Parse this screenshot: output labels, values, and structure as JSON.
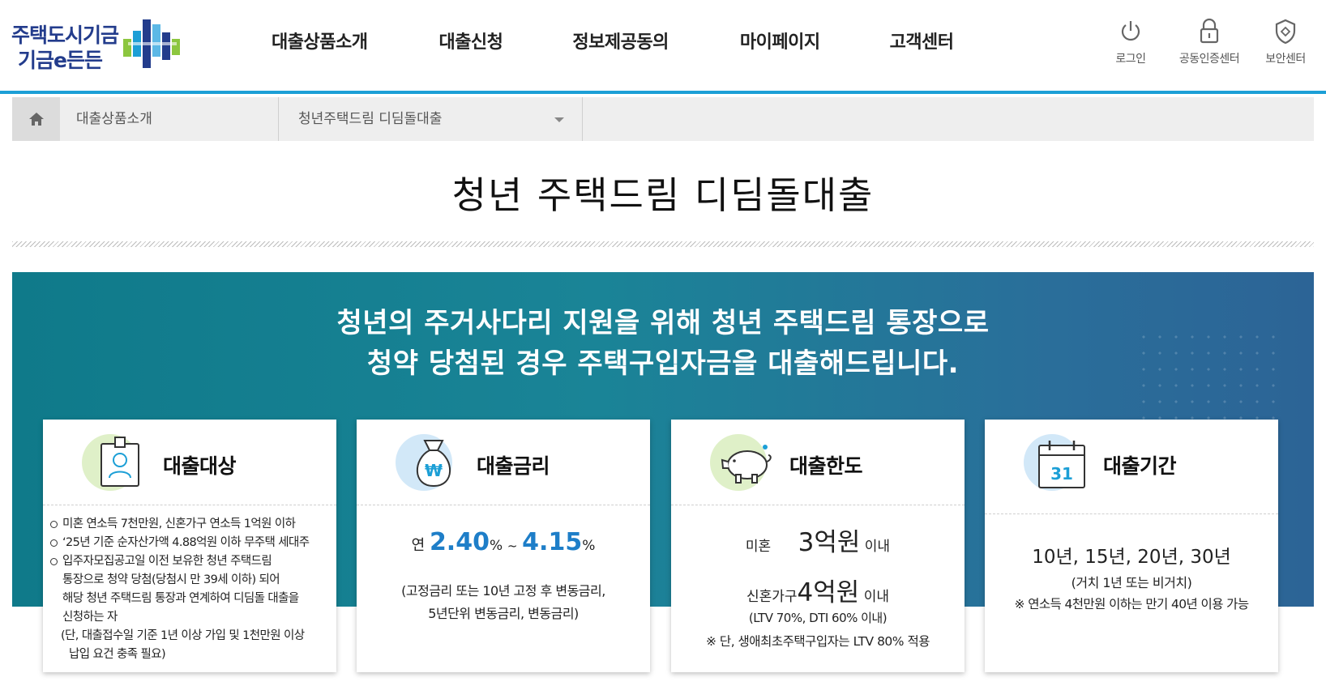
{
  "header": {
    "logo_line1": "주택도시기금",
    "logo_line2": "기금e든든",
    "nav": [
      "대출상품소개",
      "대출신청",
      "정보제공동의",
      "마이페이지",
      "고객센터"
    ],
    "util": [
      {
        "label": "로그인",
        "icon": "power-icon"
      },
      {
        "label": "공동인증센터",
        "icon": "lock-icon"
      },
      {
        "label": "보안센터",
        "icon": "shield-icon"
      }
    ],
    "accent_color": "#1c9fd6"
  },
  "breadcrumb": {
    "home_icon": "home-icon",
    "level1": "대출상품소개",
    "level2": "청년주택드림 디딤돌대출"
  },
  "page_title": "청년 주택드림 디딤돌대출",
  "hero": {
    "line1": "청년의 주거사다리 지원을 위해 청년 주택드림 통장으로",
    "line2": "청약 당첨된 경우 주택구입자금을 대출해드립니다."
  },
  "cards": {
    "target": {
      "title": "대출대상",
      "icon": "id-badge-icon",
      "items": [
        "미혼 연소득 7천만원, 신혼가구 연소득 1억원 이하",
        "‘25년 기준 순자산가액 4.88억원 이하 무주택 세대주",
        "입주자모집공고일 이전 보유한 청년 주택드림"
      ],
      "item3_cont": [
        "통장으로 청약 당첨(당첨시 만 39세 이하) 되어",
        "해당 청년 주택드림 통장과 연계하여 디딤돌 대출을",
        "신청하는 자"
      ],
      "note1": "(단, 대출접수일 기준 1년 이상 가입 및 1천만원 이상",
      "note2": "납입 요건 충족 필요)"
    },
    "rate": {
      "title": "대출금리",
      "icon": "money-bag-icon",
      "prefix": "연",
      "min": "2.40",
      "pct1": "%",
      "tilde": "~",
      "max": "4.15",
      "pct2": "%",
      "desc1": "(고정금리 또는 10년 고정 후 변동금리,",
      "desc2": "5년단위 변동금리, 변동금리)",
      "value_color": "#1e7ec8"
    },
    "limit": {
      "title": "대출한도",
      "icon": "piggy-bank-icon",
      "single_label": "미혼",
      "single_amount": "3억원",
      "single_suffix": "이내",
      "married_label": "신혼가구",
      "married_amount": "4억원",
      "married_suffix": "이내",
      "ratio": "(LTV 70%, DTI 60% 이내)",
      "note": "※ 단, 생애최초주택구입자는 LTV 80% 적용"
    },
    "term": {
      "title": "대출기간",
      "icon": "calendar-icon",
      "calendar_day": "31",
      "terms": "10년, 15년, 20년, 30년",
      "grace": "(거치 1년 또는 비거치)",
      "note": "※ 연소득 4천만원 이하는 만기 40년 이용 가능"
    }
  }
}
